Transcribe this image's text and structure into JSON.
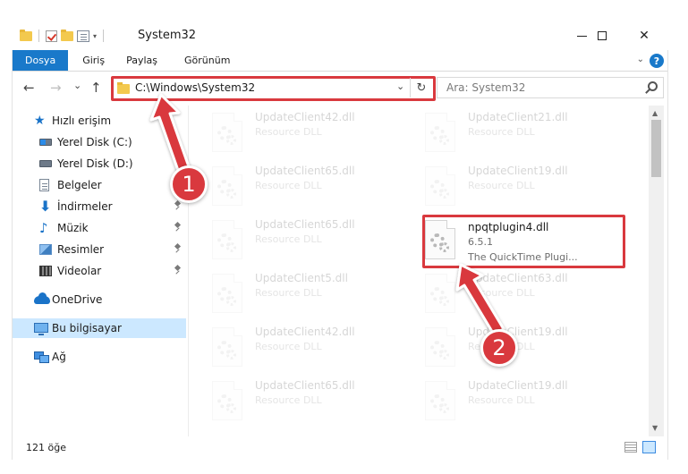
{
  "window": {
    "title": "System32",
    "minimize_glyph": "",
    "close_glyph": "✕"
  },
  "ribbon": {
    "tabs": [
      {
        "label": "Dosya"
      },
      {
        "label": "Giriş"
      },
      {
        "label": "Paylaş"
      },
      {
        "label": "Görünüm"
      }
    ],
    "help_glyph": "?",
    "expand_glyph": "⌄"
  },
  "nav": {
    "back_glyph": "←",
    "forward_glyph": "→",
    "recent_glyph": "⌄",
    "up_glyph": "↑",
    "address_path": "C:\\Windows\\System32",
    "address_dropdown_glyph": "⌄",
    "refresh_glyph": "↻",
    "search_placeholder": "Ara: System32"
  },
  "sidebar": {
    "items": [
      {
        "label": "Hızlı erişim",
        "icon": "star-icon"
      },
      {
        "label": "Yerel Disk (C:)",
        "icon": "local-disk-icon"
      },
      {
        "label": "Yerel Disk (D:)",
        "icon": "local-disk-icon"
      },
      {
        "label": "Belgeler",
        "icon": "documents-icon"
      },
      {
        "label": "İndirmeler",
        "icon": "downloads-icon"
      },
      {
        "label": "Müzik",
        "icon": "music-icon"
      },
      {
        "label": "Resimler",
        "icon": "pictures-icon"
      },
      {
        "label": "Videolar",
        "icon": "videos-icon"
      },
      {
        "label": "OneDrive",
        "icon": "onedrive-icon"
      },
      {
        "label": "Bu bilgisayar",
        "icon": "this-pc-icon"
      },
      {
        "label": "Ağ",
        "icon": "network-icon"
      }
    ],
    "star_glyph": "★",
    "download_glyph": "⬇",
    "music_glyph": "♪"
  },
  "files": {
    "left_column": [
      {
        "name": "UpdateClient42.dll",
        "type": "Resource DLL"
      },
      {
        "name": "UpdateClient65.dll",
        "type": "Resource DLL"
      },
      {
        "name": "UpdateClient65.dll",
        "type": "Resource DLL"
      },
      {
        "name": "UpdateClient5.dll",
        "type": "Resource DLL"
      },
      {
        "name": "UpdateClient42.dll",
        "type": "Resource DLL"
      },
      {
        "name": "UpdateClient65.dll",
        "type": "Resource DLL"
      }
    ],
    "right_column": [
      {
        "name": "UpdateClient21.dll",
        "type": "Resource DLL"
      },
      {
        "name": "UpdateClient19.dll",
        "type": "Resource DLL"
      },
      {
        "name": "UpdateClient63.dll",
        "type": "Resource DLL"
      },
      {
        "name": "UpdateClient19.dll",
        "type": "Resource DLL"
      },
      {
        "name": "UpdateClient19.dll",
        "type": "Resource DLL"
      }
    ],
    "highlighted": {
      "name": "npqtplugin4.dll",
      "version": "6.5.1",
      "description": "The QuickTime Plugi..."
    }
  },
  "scrollbar": {
    "up_glyph": "▲",
    "down_glyph": "▼"
  },
  "status": {
    "item_count": "121 öğe"
  },
  "annotations": {
    "step1": "1",
    "step2": "2",
    "accent_color": "#d9393e"
  },
  "colors": {
    "file_tab": "#1979ca",
    "selected_nav": "#cce8ff"
  }
}
